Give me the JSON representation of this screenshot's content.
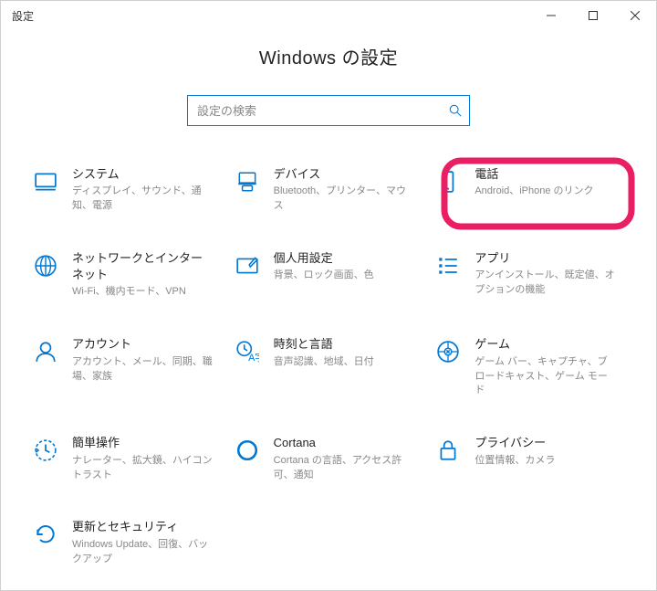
{
  "titlebar": {
    "title": "設定"
  },
  "page": {
    "title": "Windows の設定"
  },
  "search": {
    "placeholder": "設定の検索"
  },
  "categories": [
    {
      "icon": "display-icon",
      "title": "システム",
      "desc": "ディスプレイ、サウンド、通知、電源"
    },
    {
      "icon": "devices-icon",
      "title": "デバイス",
      "desc": "Bluetooth、プリンター、マウス"
    },
    {
      "icon": "phone-icon",
      "title": "電話",
      "desc": "Android、iPhone のリンク"
    },
    {
      "icon": "globe-icon",
      "title": "ネットワークとインターネット",
      "desc": "Wi-Fi、機内モード、VPN"
    },
    {
      "icon": "personalize-icon",
      "title": "個人用設定",
      "desc": "背景、ロック画面、色"
    },
    {
      "icon": "apps-icon",
      "title": "アプリ",
      "desc": "アンインストール、既定値、オプションの機能"
    },
    {
      "icon": "account-icon",
      "title": "アカウント",
      "desc": "アカウント、メール、同期、職場、家族"
    },
    {
      "icon": "time-icon",
      "title": "時刻と言語",
      "desc": "音声認識、地域、日付"
    },
    {
      "icon": "gaming-icon",
      "title": "ゲーム",
      "desc": "ゲーム バー、キャプチャ、ブロードキャスト、ゲーム モード"
    },
    {
      "icon": "ease-icon",
      "title": "簡単操作",
      "desc": "ナレーター、拡大鏡、ハイコントラスト"
    },
    {
      "icon": "cortana-icon",
      "title": "Cortana",
      "desc": "Cortana の言語、アクセス許可、通知"
    },
    {
      "icon": "privacy-icon",
      "title": "プライバシー",
      "desc": "位置情報、カメラ"
    },
    {
      "icon": "update-icon",
      "title": "更新とセキュリティ",
      "desc": "Windows Update、回復、バックアップ"
    }
  ],
  "highlight": {
    "targetIndex": 2
  }
}
